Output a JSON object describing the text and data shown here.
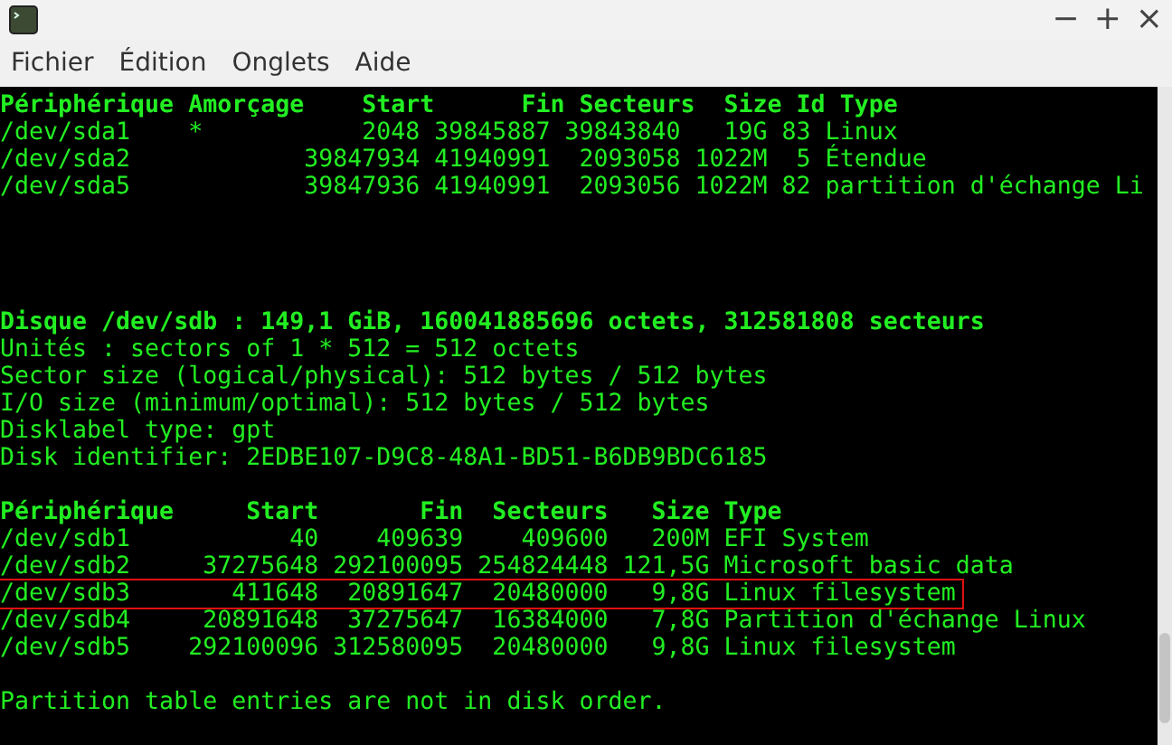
{
  "window": {
    "controls": [
      "−",
      "+",
      "×"
    ]
  },
  "menu": [
    "Fichier",
    "Édition",
    "Onglets",
    "Aide"
  ],
  "terminal": {
    "lines": [
      {
        "kind": "text",
        "text": "Périphérique Amorçage    Start      Fin Secteurs  Size Id Type",
        "bold": true,
        "highlighted": false
      },
      {
        "kind": "text",
        "text": "/dev/sda1    *           2048 39845887 39843840   19G 83 Linux",
        "bold": false,
        "highlighted": false
      },
      {
        "kind": "text",
        "text": "/dev/sda2            39847934 41940991  2093058 1022M  5 Étendue",
        "bold": false,
        "highlighted": false
      },
      {
        "kind": "text",
        "text": "/dev/sda5            39847936 41940991  2093056 1022M 82 partition d'échange Li",
        "bold": false,
        "highlighted": false
      },
      {
        "kind": "blank"
      },
      {
        "kind": "blank"
      },
      {
        "kind": "blank"
      },
      {
        "kind": "blank"
      },
      {
        "kind": "text",
        "text": "Disque /dev/sdb : 149,1 GiB, 160041885696 octets, 312581808 secteurs",
        "bold": true,
        "highlighted": false
      },
      {
        "kind": "text",
        "text": "Unités : sectors of 1 * 512 = 512 octets",
        "bold": false,
        "highlighted": false
      },
      {
        "kind": "text",
        "text": "Sector size (logical/physical): 512 bytes / 512 bytes",
        "bold": false,
        "highlighted": false
      },
      {
        "kind": "text",
        "text": "I/O size (minimum/optimal): 512 bytes / 512 bytes",
        "bold": false,
        "highlighted": false
      },
      {
        "kind": "text",
        "text": "Disklabel type: gpt",
        "bold": false,
        "highlighted": false
      },
      {
        "kind": "text",
        "text": "Disk identifier: 2EDBE107-D9C8-48A1-BD51-B6DB9BDC6185",
        "bold": false,
        "highlighted": false
      },
      {
        "kind": "blank"
      },
      {
        "kind": "text",
        "text": "Périphérique     Start       Fin  Secteurs   Size Type",
        "bold": true,
        "highlighted": false
      },
      {
        "kind": "text",
        "text": "/dev/sdb1           40    409639    409600   200M EFI System",
        "bold": false,
        "highlighted": false
      },
      {
        "kind": "text",
        "text": "/dev/sdb2     37275648 292100095 254824448 121,5G Microsoft basic data",
        "bold": false,
        "highlighted": false
      },
      {
        "kind": "text",
        "text": "/dev/sdb3       411648  20891647  20480000   9,8G Linux filesystem",
        "bold": false,
        "highlighted": true
      },
      {
        "kind": "text",
        "text": "/dev/sdb4     20891648  37275647  16384000   7,8G Partition d'échange Linux",
        "bold": false,
        "highlighted": false
      },
      {
        "kind": "text",
        "text": "/dev/sdb5    292100096 312580095  20480000   9,8G Linux filesystem",
        "bold": false,
        "highlighted": false
      },
      {
        "kind": "blank"
      },
      {
        "kind": "text",
        "text": "Partition table entries are not in disk order.",
        "bold": false,
        "highlighted": false
      }
    ]
  }
}
